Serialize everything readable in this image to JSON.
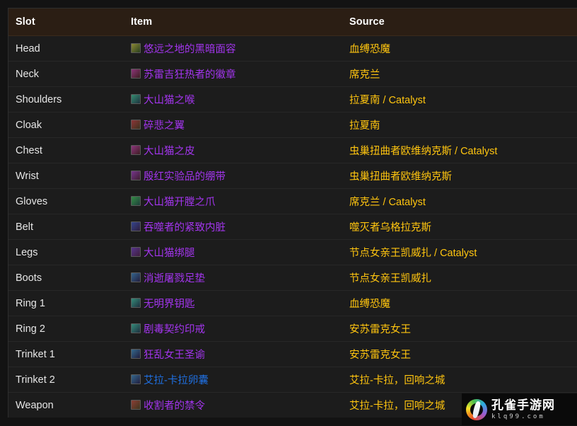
{
  "theme": {
    "page_bg": "#131313",
    "table_bg": "#1c1c1c",
    "header_bg": "#2b1e14",
    "header_text": "#ffffff",
    "row_text": "#e8e8e8",
    "divider": "#272727",
    "epic_color": "#a335ee",
    "rare_color": "#1f6fe0",
    "source_color": "#ffc50f"
  },
  "table": {
    "columns": [
      {
        "key": "slot",
        "label": "Slot"
      },
      {
        "key": "item",
        "label": "Item"
      },
      {
        "key": "source",
        "label": "Source"
      }
    ],
    "rows": [
      {
        "slot": "Head",
        "item": "悠远之地的黑暗面容",
        "item_quality": "epic",
        "icon": "item-icon-head",
        "source": "血缚恐魔"
      },
      {
        "slot": "Neck",
        "item": "苏雷吉狂热者的徽章",
        "item_quality": "epic",
        "icon": "item-icon-neck",
        "source": "席克兰"
      },
      {
        "slot": "Shoulders",
        "item": "大山猫之喉",
        "item_quality": "epic",
        "icon": "item-icon-shoulders",
        "source": "拉夏南 / Catalyst"
      },
      {
        "slot": "Cloak",
        "item": "碎悲之翼",
        "item_quality": "epic",
        "icon": "item-icon-cloak",
        "source": "拉夏南"
      },
      {
        "slot": "Chest",
        "item": "大山猫之皮",
        "item_quality": "epic",
        "icon": "item-icon-chest",
        "source": "虫巢扭曲者欧维纳克斯 / Catalyst"
      },
      {
        "slot": "Wrist",
        "item": "殷红实验品的绷带",
        "item_quality": "epic",
        "icon": "item-icon-wrist",
        "source": "虫巢扭曲者欧维纳克斯"
      },
      {
        "slot": "Gloves",
        "item": "大山猫开膛之爪",
        "item_quality": "epic",
        "icon": "item-icon-gloves",
        "source": "席克兰 / Catalyst"
      },
      {
        "slot": "Belt",
        "item": "吞噬者的紧致内脏",
        "item_quality": "epic",
        "icon": "item-icon-belt",
        "source": "噬灭者乌格拉克斯"
      },
      {
        "slot": "Legs",
        "item": "大山猫绑腿",
        "item_quality": "epic",
        "icon": "item-icon-legs",
        "source": "节点女亲王凯威扎 / Catalyst"
      },
      {
        "slot": "Boots",
        "item": "消逝屠戮足垫",
        "item_quality": "epic",
        "icon": "item-icon-boots",
        "source": "节点女亲王凯威扎"
      },
      {
        "slot": "Ring 1",
        "item": "无明界钥匙",
        "item_quality": "epic",
        "icon": "item-icon-ring1",
        "source": "血缚恐魔"
      },
      {
        "slot": "Ring 2",
        "item": "剧毒契约印戒",
        "item_quality": "epic",
        "icon": "item-icon-ring2",
        "source": "安苏雷克女王"
      },
      {
        "slot": "Trinket 1",
        "item": "狂乱女王圣谕",
        "item_quality": "epic",
        "icon": "item-icon-trinket1",
        "source": "安苏雷克女王"
      },
      {
        "slot": "Trinket 2",
        "item": "艾拉-卡拉卵囊",
        "item_quality": "rare",
        "icon": "item-icon-trinket2",
        "source": "艾拉-卡拉，回响之城"
      },
      {
        "slot": "Weapon",
        "item": "收割者的禁令",
        "item_quality": "epic",
        "icon": "item-icon-weapon",
        "source": "艾拉-卡拉，回响之城"
      }
    ]
  },
  "watermark": {
    "logo_icon": "peacock-logo-icon",
    "title": "孔雀手游网",
    "subtitle": "klq99.com"
  }
}
